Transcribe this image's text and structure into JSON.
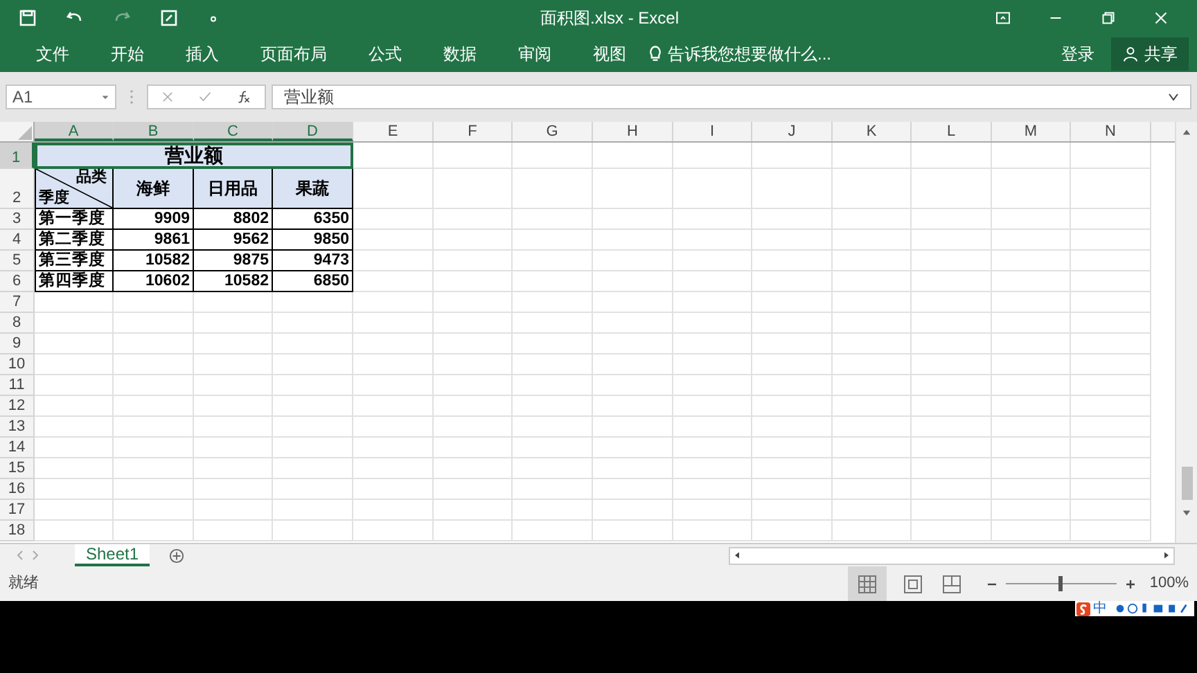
{
  "window": {
    "title": "面积图.xlsx - Excel"
  },
  "ribbon_tabs": [
    {
      "label": "文件",
      "selected": false
    },
    {
      "label": "开始",
      "selected": false
    },
    {
      "label": "插入",
      "selected": false
    },
    {
      "label": "页面布局",
      "selected": false
    },
    {
      "label": "公式",
      "selected": false
    },
    {
      "label": "数据",
      "selected": false
    },
    {
      "label": "审阅",
      "selected": false
    },
    {
      "label": "视图",
      "selected": false
    }
  ],
  "tell_me": {
    "placeholder": "告诉我您想要做什么..."
  },
  "sign_in": "登录",
  "share": "共享",
  "formula_bar": {
    "name_box": "A1",
    "value": "营业额"
  },
  "columns": [
    {
      "label": "A",
      "selected": true
    },
    {
      "label": "B",
      "selected": true
    },
    {
      "label": "C",
      "selected": true
    },
    {
      "label": "D",
      "selected": true
    },
    {
      "label": "E",
      "selected": false
    },
    {
      "label": "F",
      "selected": false
    },
    {
      "label": "G",
      "selected": false
    },
    {
      "label": "H",
      "selected": false
    },
    {
      "label": "I",
      "selected": false
    },
    {
      "label": "J",
      "selected": false
    },
    {
      "label": "K",
      "selected": false
    },
    {
      "label": "L",
      "selected": false
    },
    {
      "label": "M",
      "selected": false
    },
    {
      "label": "N",
      "selected": false
    }
  ],
  "row_headers": [
    {
      "label": "1",
      "selected": true
    },
    {
      "label": "2",
      "selected": false
    },
    {
      "label": "3",
      "selected": false
    },
    {
      "label": "4",
      "selected": false
    },
    {
      "label": "5",
      "selected": false
    },
    {
      "label": "6",
      "selected": false
    },
    {
      "label": "7",
      "selected": false
    },
    {
      "label": "8",
      "selected": false
    },
    {
      "label": "9",
      "selected": false
    },
    {
      "label": "10",
      "selected": false
    },
    {
      "label": "11",
      "selected": false
    },
    {
      "label": "12",
      "selected": false
    },
    {
      "label": "13",
      "selected": false
    },
    {
      "label": "14",
      "selected": false
    },
    {
      "label": "15",
      "selected": false
    },
    {
      "label": "16",
      "selected": false
    },
    {
      "label": "17",
      "selected": false
    },
    {
      "label": "18",
      "selected": false
    }
  ],
  "table": {
    "title": "营业额",
    "corner_top": "品类",
    "corner_bottom": "季度",
    "headers": [
      "海鲜",
      "日用品",
      "果蔬"
    ],
    "rows": [
      [
        "第一季度",
        "9909",
        "8802",
        "6350"
      ],
      [
        "第二季度",
        "9861",
        "9562",
        "9850"
      ],
      [
        "第三季度",
        "10582",
        "9875",
        "9473"
      ],
      [
        "第四季度",
        "10602",
        "10582",
        "6850"
      ]
    ]
  },
  "sheet_tabs": [
    {
      "label": "Sheet1",
      "selected": true
    }
  ],
  "status_bar": {
    "text": "就绪",
    "zoom": "100%",
    "zoom_slider": {
      "level": 0.5
    }
  },
  "ime": {
    "text": "中"
  }
}
